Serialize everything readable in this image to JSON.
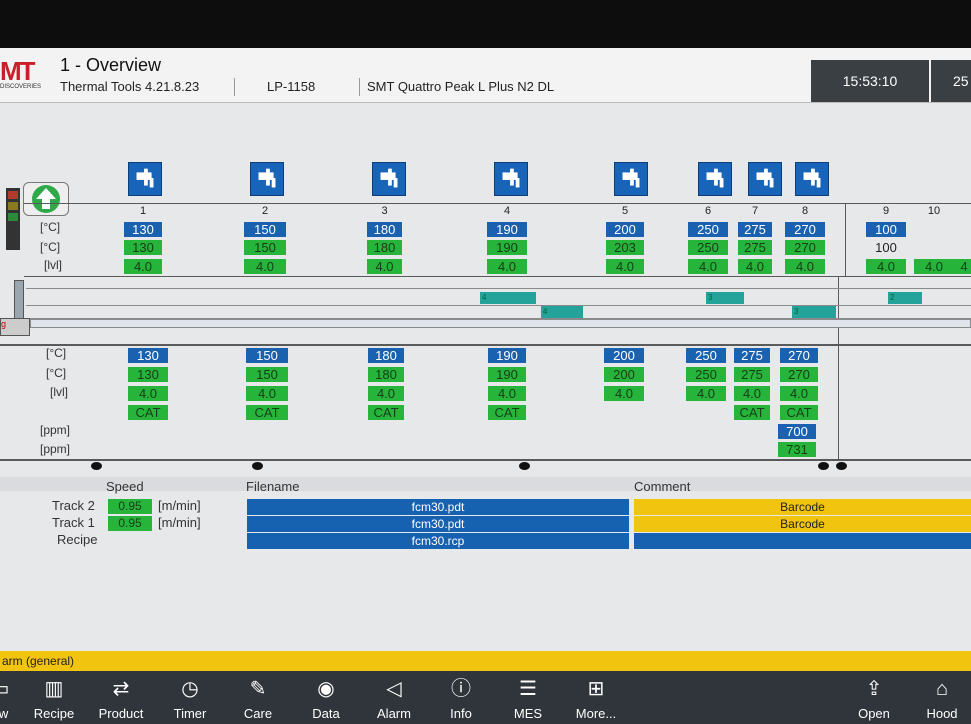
{
  "header": {
    "logo_text": "MT",
    "logo_sub": "DISCOVERIES",
    "title": "1 - Overview",
    "version": "Thermal Tools 4.21.8.23",
    "line": "LP-1158",
    "machine": "SMT Quattro Peak L Plus N2 DL",
    "time": "15:53:10",
    "date_partial": "25"
  },
  "labels": {
    "top": [
      "[°C]",
      "[°C]",
      "[lvl]"
    ],
    "bottom": [
      "[°C]",
      "[°C]",
      "[lvl]",
      "[ppm]",
      "[ppm]"
    ]
  },
  "top_zones": [
    {
      "num": "1",
      "set": "130",
      "act": "130",
      "lvl": "4.0"
    },
    {
      "num": "2",
      "set": "150",
      "act": "150",
      "lvl": "4.0"
    },
    {
      "num": "3",
      "set": "180",
      "act": "180",
      "lvl": "4.0"
    },
    {
      "num": "4",
      "set": "190",
      "act": "190",
      "lvl": "4.0"
    },
    {
      "num": "5",
      "set": "200",
      "act": "203",
      "lvl": "4.0"
    },
    {
      "num": "6",
      "set": "250",
      "act": "250",
      "lvl": "4.0"
    },
    {
      "num": "7",
      "set": "275",
      "act": "275",
      "lvl": "4.0"
    },
    {
      "num": "8",
      "set": "270",
      "act": "270",
      "lvl": "4.0"
    },
    {
      "num": "9",
      "set": "100",
      "act": "100",
      "lvl": "4.0"
    },
    {
      "num": "10",
      "set": "",
      "act": "",
      "lvl": "4.0"
    },
    {
      "num": "",
      "set": "",
      "act": "",
      "lvl": "4"
    }
  ],
  "bottom_zones": [
    {
      "set": "130",
      "act": "130",
      "lvl": "4.0",
      "cat": "CAT"
    },
    {
      "set": "150",
      "act": "150",
      "lvl": "4.0",
      "cat": "CAT"
    },
    {
      "set": "180",
      "act": "180",
      "lvl": "4.0",
      "cat": "CAT"
    },
    {
      "set": "190",
      "act": "190",
      "lvl": "4.0",
      "cat": "CAT"
    },
    {
      "set": "200",
      "act": "200",
      "lvl": "4.0",
      "cat": ""
    },
    {
      "set": "250",
      "act": "250",
      "lvl": "4.0",
      "cat": ""
    },
    {
      "set": "275",
      "act": "275",
      "lvl": "4.0",
      "cat": "CAT"
    },
    {
      "set": "270",
      "act": "270",
      "lvl": "4.0",
      "cat": "CAT"
    }
  ],
  "ppm": {
    "set": "700",
    "act": "731"
  },
  "boards": [
    "4",
    "4",
    "3",
    "3",
    "2"
  ],
  "tracks": {
    "speed_header": "Speed",
    "filename_header": "Filename",
    "comment_header": "Comment",
    "rows": [
      {
        "label": "Track 2",
        "speed": "0.95",
        "unit": "[m/min]",
        "file": "fcm30.pdt",
        "comment": "Barcode"
      },
      {
        "label": "Track 1",
        "speed": "0.95",
        "unit": "[m/min]",
        "file": "fcm30.pdt",
        "comment": "Barcode"
      },
      {
        "label": "Recipe",
        "speed": "",
        "unit": "",
        "file": "fcm30.rcp",
        "comment": ""
      }
    ]
  },
  "status": {
    "text": "arm (general)"
  },
  "nav": [
    {
      "label": "ew",
      "icon": "overview-icon"
    },
    {
      "label": "Recipe",
      "icon": "recipe-icon"
    },
    {
      "label": "Product",
      "icon": "product-icon"
    },
    {
      "label": "Timer",
      "icon": "timer-icon"
    },
    {
      "label": "Care",
      "icon": "care-icon"
    },
    {
      "label": "Data",
      "icon": "data-icon"
    },
    {
      "label": "Alarm",
      "icon": "alarm-icon"
    },
    {
      "label": "Info",
      "icon": "info-icon"
    },
    {
      "label": "MES",
      "icon": "mes-icon"
    },
    {
      "label": "More...",
      "icon": "more-icon"
    },
    {
      "label": "Open",
      "icon": "open-icon"
    },
    {
      "label": "Hood",
      "icon": "hood-icon"
    }
  ],
  "colors": {
    "set_value": "#1a61b0",
    "actual_value": "#26b53a",
    "status_bar": "#f1c40f",
    "nav_bar": "#2f353a"
  }
}
